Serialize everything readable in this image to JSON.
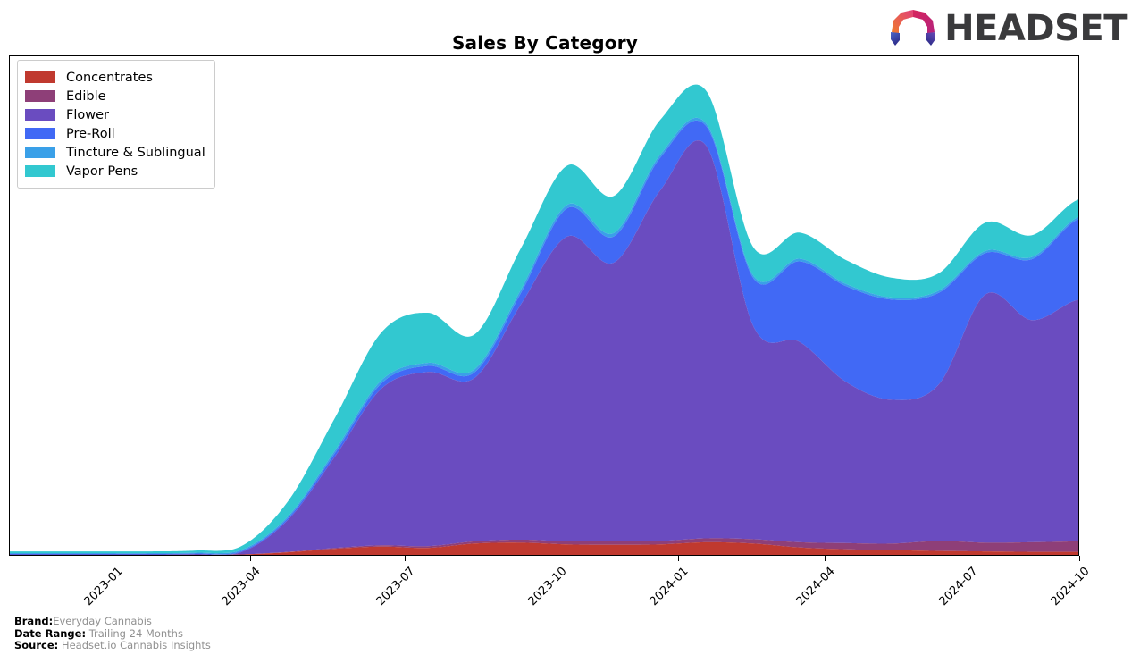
{
  "header": {
    "title": "Sales By Category",
    "logo_word": "HEADSET",
    "logo_mark_name": "headset-logo-mark"
  },
  "footer": {
    "brand_key": "Brand:",
    "brand_value": "Everyday Cannabis",
    "date_range_key": "Date Range:",
    "date_range_value": "Trailing 24 Months",
    "source_key": "Source:",
    "source_value": "Headset.io Cannabis Insights"
  },
  "legend": {
    "position": "upper-left",
    "items": [
      {
        "label": "Concentrates",
        "color": "#c0392f"
      },
      {
        "label": "Edible",
        "color": "#8e3f78"
      },
      {
        "label": "Flower",
        "color": "#6a4cc0"
      },
      {
        "label": "Pre-Roll",
        "color": "#4169f5"
      },
      {
        "label": "Tincture & Sublingual",
        "color": "#3aa0e8"
      },
      {
        "label": "Vapor Pens",
        "color": "#32c8d0"
      }
    ]
  },
  "chart_data": {
    "type": "area",
    "stacked": true,
    "title": "Sales By Category",
    "xlabel": "",
    "ylabel": "",
    "grid": false,
    "legend_position": "upper left",
    "x_tick_labels": [
      "2023-01",
      "2023-04",
      "2023-07",
      "2023-10",
      "2024-01",
      "2024-04",
      "2024-07",
      "2024-10"
    ],
    "x_tick_positions_pct": [
      9.7,
      22.5,
      37.0,
      51.2,
      62.5,
      76.2,
      89.6,
      100.0
    ],
    "x": [
      "2022-11",
      "2022-12",
      "2023-01",
      "2023-02",
      "2023-03",
      "2023-04",
      "2023-05",
      "2023-06",
      "2023-07",
      "2023-08",
      "2023-09",
      "2023-10",
      "2023-11",
      "2023-12",
      "2024-01",
      "2024-02",
      "2024-03",
      "2024-04",
      "2024-05",
      "2024-06",
      "2024-07",
      "2024-08",
      "2024-09",
      "2024-10"
    ],
    "ylim": [
      0,
      100
    ],
    "y_axis_visible": false,
    "series": [
      {
        "name": "Concentrates",
        "color": "#c0392f",
        "values": [
          0.0,
          0.0,
          0.0,
          0.0,
          0.0,
          0.1,
          0.6,
          1.4,
          1.9,
          1.6,
          2.6,
          2.8,
          2.4,
          2.3,
          2.4,
          2.9,
          2.6,
          1.7,
          1.3,
          1.1,
          0.9,
          0.8,
          0.7,
          0.7
        ]
      },
      {
        "name": "Edible",
        "color": "#8e3f78",
        "values": [
          0.0,
          0.0,
          0.0,
          0.0,
          0.0,
          0.0,
          0.1,
          0.2,
          0.3,
          0.4,
          0.5,
          0.7,
          0.7,
          0.8,
          0.8,
          0.9,
          1.0,
          1.2,
          1.4,
          1.5,
          2.3,
          2.0,
          2.2,
          2.4
        ]
      },
      {
        "name": "Flower",
        "color": "#6a4cc0",
        "values": [
          0.1,
          0.1,
          0.1,
          0.1,
          0.2,
          0.6,
          7.5,
          21.0,
          36.0,
          40.0,
          37.5,
          54.0,
          70.0,
          64.0,
          80.5,
          90.0,
          49.0,
          46.0,
          37.0,
          33.0,
          36.0,
          57.0,
          51.0,
          55.5
        ]
      },
      {
        "name": "Pre-Roll",
        "color": "#4169f5",
        "values": [
          0.1,
          0.1,
          0.1,
          0.1,
          0.1,
          0.2,
          0.4,
          0.8,
          1.2,
          1.4,
          1.3,
          2.6,
          6.5,
          6.0,
          7.5,
          4.5,
          11.0,
          18.5,
          22.0,
          23.0,
          21.0,
          9.5,
          14.0,
          18.5
        ]
      },
      {
        "name": "Tincture & Sublingual",
        "color": "#3aa0e8",
        "values": [
          0.2,
          0.2,
          0.2,
          0.2,
          0.2,
          0.3,
          0.4,
          0.6,
          0.7,
          0.7,
          0.7,
          0.8,
          0.8,
          0.8,
          0.7,
          0.6,
          0.6,
          0.6,
          0.5,
          0.5,
          0.5,
          0.5,
          0.5,
          0.5
        ]
      },
      {
        "name": "Vapor Pens",
        "color": "#32c8d0",
        "values": [
          0.4,
          0.4,
          0.4,
          0.4,
          0.5,
          0.9,
          3.5,
          7.5,
          11.0,
          11.5,
          8.0,
          9.5,
          9.0,
          8.5,
          8.0,
          7.5,
          6.5,
          6.0,
          5.5,
          4.5,
          4.0,
          6.5,
          5.0,
          4.0
        ]
      }
    ]
  }
}
